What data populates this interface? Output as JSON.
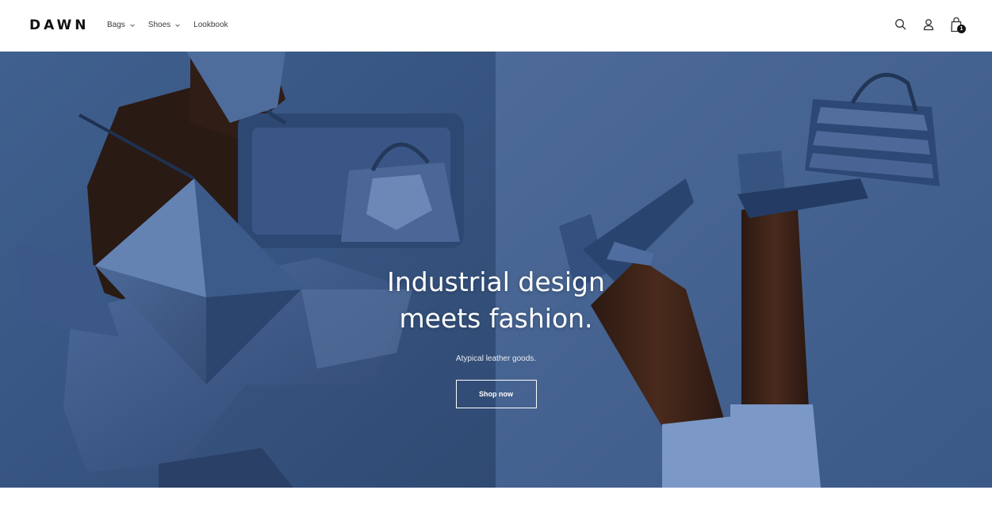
{
  "header": {
    "logo": "DAWN",
    "nav": [
      {
        "label": "Bags",
        "has_dropdown": true
      },
      {
        "label": "Shoes",
        "has_dropdown": true
      },
      {
        "label": "Lookbook",
        "has_dropdown": false
      }
    ],
    "icons": [
      "search-icon",
      "account-icon",
      "cart-icon"
    ],
    "cart_count": "1"
  },
  "hero": {
    "title_line1": "Industrial design",
    "title_line2": "meets fashion.",
    "subtitle": "Atypical leather goods.",
    "button_label": "Shop now",
    "colors": {
      "left_bg": "#3a5a8b",
      "right_bg": "#42608f",
      "text": "#ffffff"
    }
  }
}
